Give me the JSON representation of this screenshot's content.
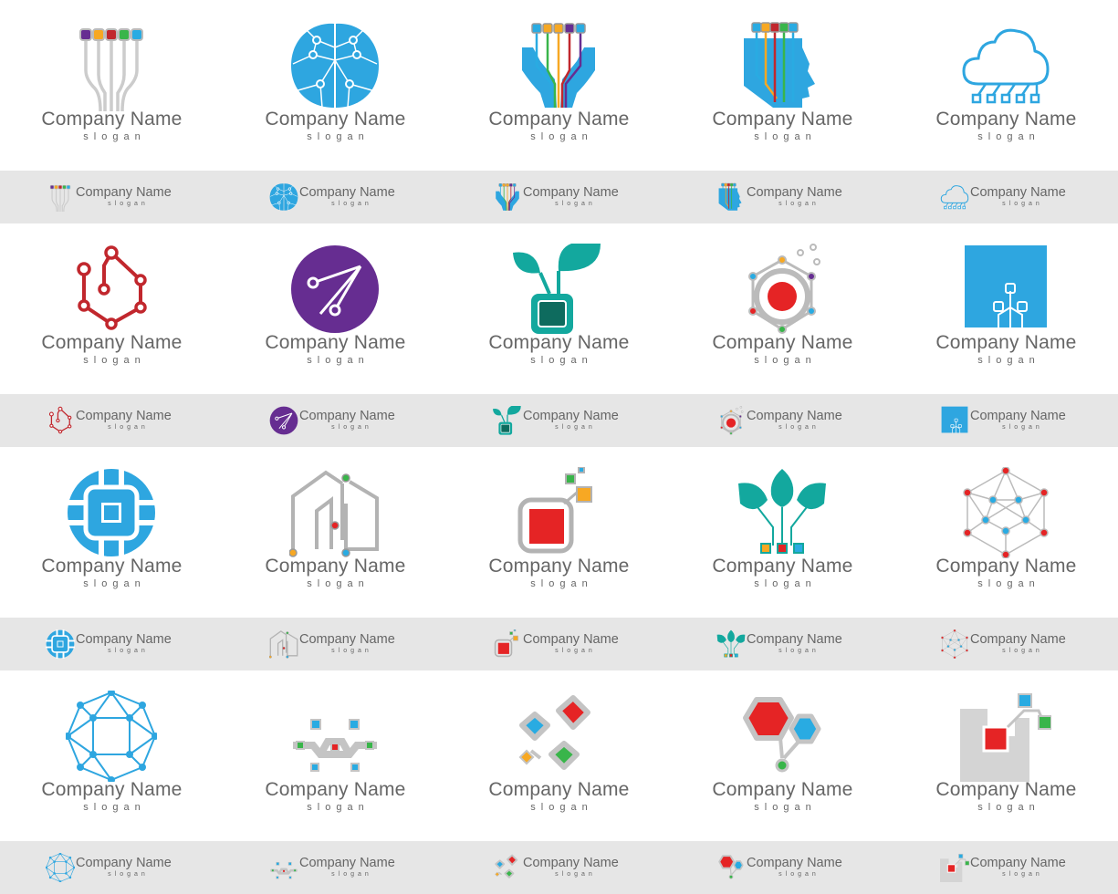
{
  "colors": {
    "band": "#e6e6e6",
    "text": "#666666",
    "blue": "#2ea6e0",
    "red": "#e52425",
    "teal": "#13a89e",
    "purple": "#662d91",
    "grey": "#c4c4c4"
  },
  "logos": [
    {
      "name": "Company Name",
      "slogan": "slogan",
      "icon": "circuit-fingers-icon"
    },
    {
      "name": "Company Name",
      "slogan": "slogan",
      "icon": "brain-circuit-icon"
    },
    {
      "name": "Company Name",
      "slogan": "slogan",
      "icon": "hands-circuit-icon"
    },
    {
      "name": "Company Name",
      "slogan": "slogan",
      "icon": "head-circuit-icon"
    },
    {
      "name": "Company Name",
      "slogan": "slogan",
      "icon": "cloud-circuit-icon"
    },
    {
      "name": "Company Name",
      "slogan": "slogan",
      "icon": "hexagon-nodes-icon"
    },
    {
      "name": "Company Name",
      "slogan": "slogan",
      "icon": "purple-circle-circuit-icon"
    },
    {
      "name": "Company Name",
      "slogan": "slogan",
      "icon": "plant-chip-icon"
    },
    {
      "name": "Company Name",
      "slogan": "slogan",
      "icon": "target-hexagon-icon"
    },
    {
      "name": "Company Name",
      "slogan": "slogan",
      "icon": "blue-square-circuit-icon"
    },
    {
      "name": "Company Name",
      "slogan": "slogan",
      "icon": "chip-circle-icon"
    },
    {
      "name": "Company Name",
      "slogan": "slogan",
      "icon": "house-circuit-icon"
    },
    {
      "name": "Company Name",
      "slogan": "slogan",
      "icon": "red-square-chip-icon"
    },
    {
      "name": "Company Name",
      "slogan": "slogan",
      "icon": "tree-circuit-icon"
    },
    {
      "name": "Company Name",
      "slogan": "slogan",
      "icon": "hexagon-network-icon"
    },
    {
      "name": "Company Name",
      "slogan": "slogan",
      "icon": "network-ring-icon"
    },
    {
      "name": "Company Name",
      "slogan": "slogan",
      "icon": "zigzag-circuit-icon"
    },
    {
      "name": "Company Name",
      "slogan": "slogan",
      "icon": "diamond-chips-icon"
    },
    {
      "name": "Company Name",
      "slogan": "slogan",
      "icon": "hexagon-molecule-icon"
    },
    {
      "name": "Company Name",
      "slogan": "slogan",
      "icon": "block-squares-icon"
    }
  ]
}
